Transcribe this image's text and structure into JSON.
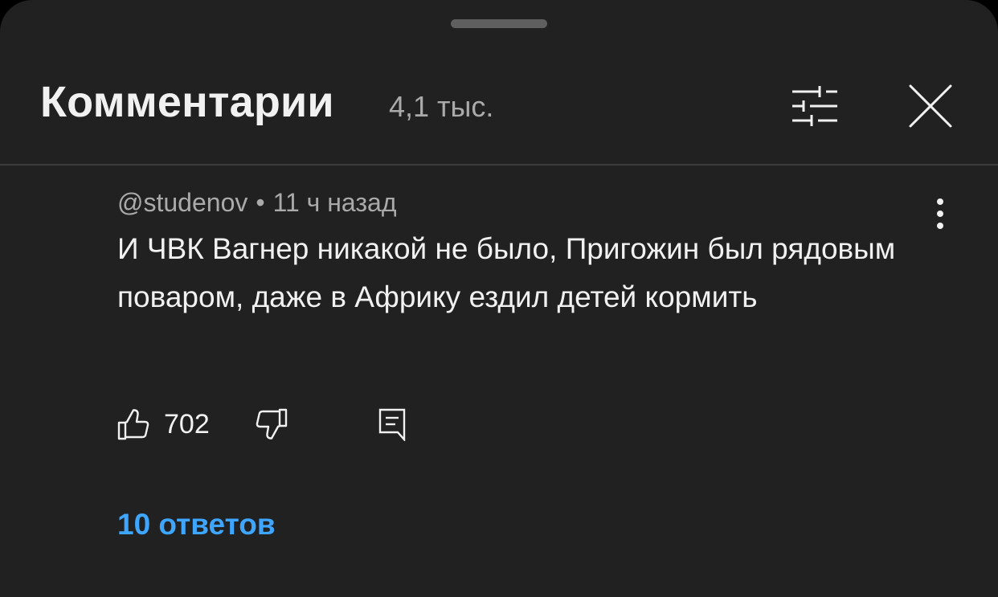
{
  "header": {
    "title": "Комментарии",
    "count": "4,1 тыс."
  },
  "icons": {
    "filter": "sliders-icon",
    "close": "close-icon",
    "more": "more-vertical-icon",
    "like": "thumbs-up-icon",
    "dislike": "thumbs-down-icon",
    "reply": "reply-comment-icon"
  },
  "comment": {
    "author": "@studenov",
    "separator": "•",
    "time": "11 ч назад",
    "text": "И ЧВК Вагнер никакой не было, Пригожин был рядовым поваром, даже в Африку ездил детей кормить",
    "likes": "702",
    "replies_label": "10 ответов"
  },
  "colors": {
    "background": "#212121",
    "link": "#3ea6ff",
    "secondary_text": "#aaaaaa",
    "primary_text": "#f1f1f1"
  }
}
